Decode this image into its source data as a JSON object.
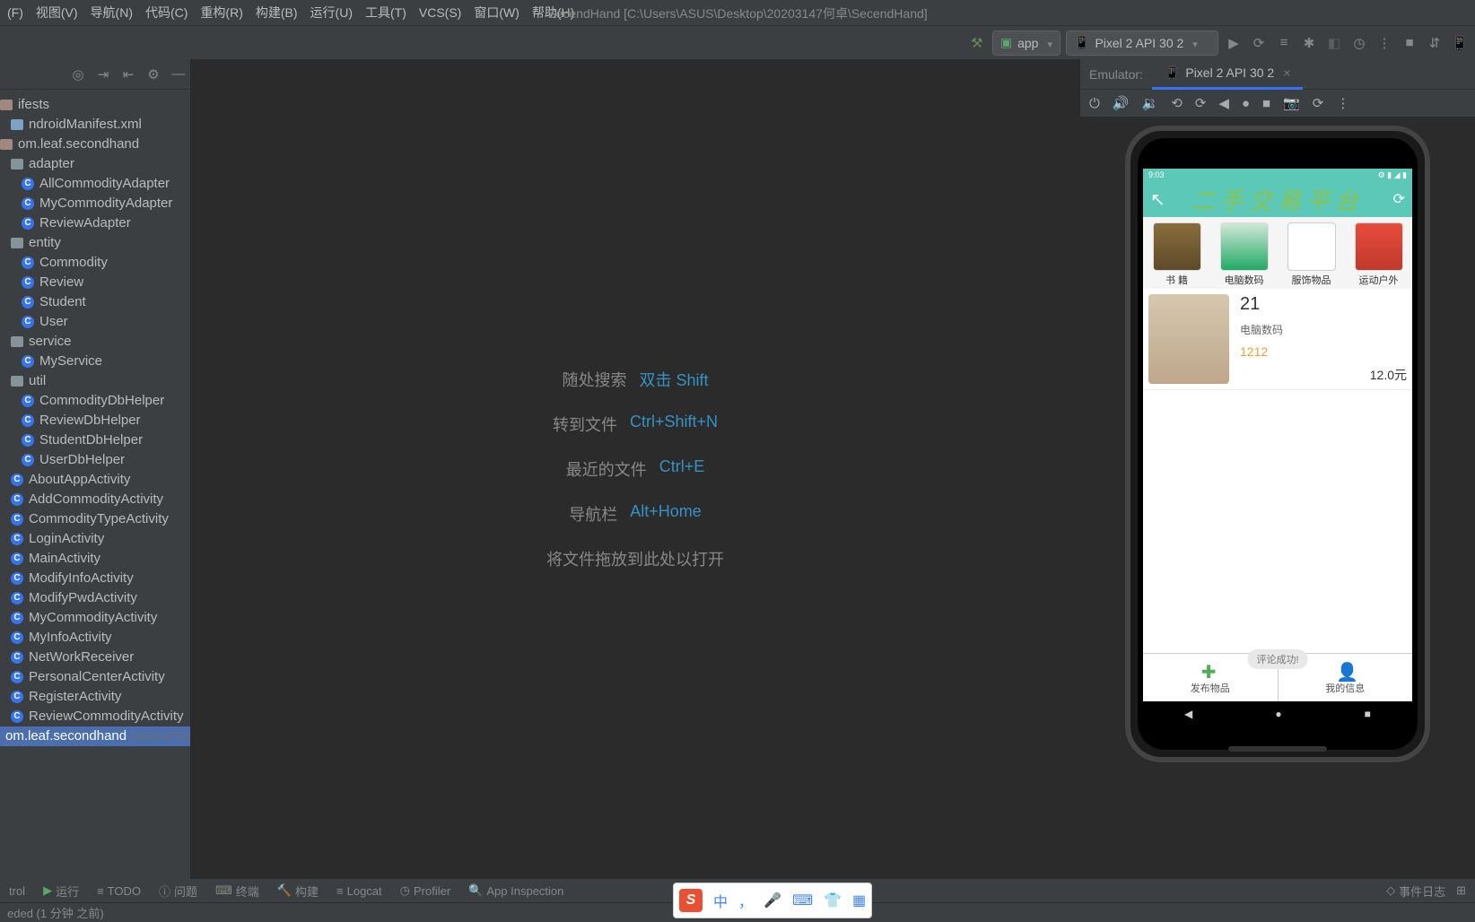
{
  "title": "SecendHand [C:\\Users\\ASUS\\Desktop\\20203147何卓\\SecendHand]",
  "menu": [
    "(F)",
    "视图(V)",
    "导航(N)",
    "代码(C)",
    "重构(R)",
    "构建(B)",
    "运行(U)",
    "工具(T)",
    "VCS(S)",
    "窗口(W)",
    "帮助(H)"
  ],
  "runConfig": "app",
  "device": "Pixel 2 API 30 2",
  "tree": {
    "items": [
      {
        "t": "ifests",
        "type": "pkg"
      },
      {
        "t": "ndroidManifest.xml",
        "type": "file",
        "indent": 1
      },
      {
        "t": "om.leaf.secondhand",
        "type": "pkg"
      },
      {
        "t": "adapter",
        "type": "folder",
        "indent": 1
      },
      {
        "t": "AllCommodityAdapter",
        "type": "class",
        "indent": 2
      },
      {
        "t": "MyCommodityAdapter",
        "type": "class",
        "indent": 2
      },
      {
        "t": "ReviewAdapter",
        "type": "class",
        "indent": 2
      },
      {
        "t": "entity",
        "type": "folder",
        "indent": 1
      },
      {
        "t": "Commodity",
        "type": "class",
        "indent": 2
      },
      {
        "t": "Review",
        "type": "class",
        "indent": 2
      },
      {
        "t": "Student",
        "type": "class",
        "indent": 2
      },
      {
        "t": "User",
        "type": "class",
        "indent": 2
      },
      {
        "t": "service",
        "type": "folder",
        "indent": 1
      },
      {
        "t": "MyService",
        "type": "class",
        "indent": 2
      },
      {
        "t": "util",
        "type": "folder",
        "indent": 1
      },
      {
        "t": "CommodityDbHelper",
        "type": "class",
        "indent": 2
      },
      {
        "t": "ReviewDbHelper",
        "type": "class",
        "indent": 2
      },
      {
        "t": "StudentDbHelper",
        "type": "class",
        "indent": 2
      },
      {
        "t": "UserDbHelper",
        "type": "class",
        "indent": 2
      },
      {
        "t": "AboutAppActivity",
        "type": "class",
        "indent": 1
      },
      {
        "t": "AddCommodityActivity",
        "type": "class",
        "indent": 1
      },
      {
        "t": "CommodityTypeActivity",
        "type": "class",
        "indent": 1
      },
      {
        "t": "LoginActivity",
        "type": "class",
        "indent": 1
      },
      {
        "t": "MainActivity",
        "type": "class",
        "indent": 1
      },
      {
        "t": "ModifyInfoActivity",
        "type": "class",
        "indent": 1
      },
      {
        "t": "ModifyPwdActivity",
        "type": "class",
        "indent": 1
      },
      {
        "t": "MyCommodityActivity",
        "type": "class",
        "indent": 1
      },
      {
        "t": "MyInfoActivity",
        "type": "class",
        "indent": 1
      },
      {
        "t": "NetWorkReceiver",
        "type": "class",
        "indent": 1
      },
      {
        "t": "PersonalCenterActivity",
        "type": "class",
        "indent": 1
      },
      {
        "t": "RegisterActivity",
        "type": "class",
        "indent": 1
      },
      {
        "t": "ReviewCommodityActivity",
        "type": "class",
        "indent": 1
      },
      {
        "t": "om.leaf.secondhand (androidTest)",
        "type": "pkg",
        "sel": true
      }
    ]
  },
  "hints": [
    {
      "l": "随处搜索",
      "k": "双击 Shift"
    },
    {
      "l": "转到文件",
      "k": "Ctrl+Shift+N"
    },
    {
      "l": "最近的文件",
      "k": "Ctrl+E"
    },
    {
      "l": "导航栏",
      "k": "Alt+Home"
    }
  ],
  "dropHint": "将文件拖放到此处以打开",
  "emulator": {
    "label": "Emulator:",
    "tab": "Pixel 2 API 30 2"
  },
  "phone": {
    "time": "9:03",
    "appTitle": "二手交易平台",
    "cats": [
      {
        "l": "书    籍"
      },
      {
        "l": "电脑数码"
      },
      {
        "l": "服饰物品"
      },
      {
        "l": "运动户外"
      }
    ],
    "item": {
      "name": "21",
      "sub": "电脑数码",
      "code": "1212",
      "price": "12.0元"
    },
    "toast": "评论成功!",
    "nav": [
      {
        "l": "发布物品"
      },
      {
        "l": "我的信息"
      }
    ]
  },
  "toolWindows": [
    "trol",
    "运行",
    "TODO",
    "问题",
    "终端",
    "构建",
    "Logcat",
    "Profiler",
    "App Inspection"
  ],
  "eventLog": "事件日志",
  "status": "eded (1 分钟 之前)",
  "ime": "中"
}
